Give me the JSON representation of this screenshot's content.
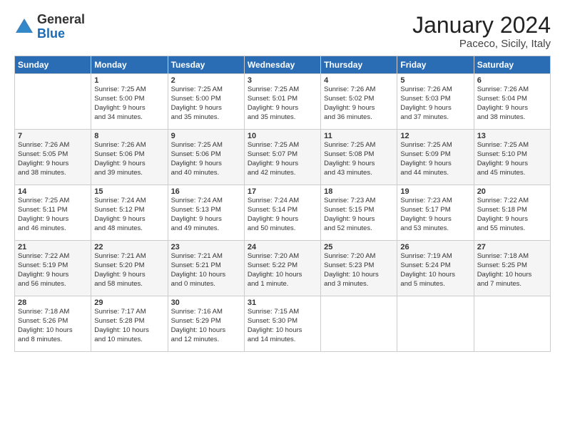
{
  "header": {
    "logo_general": "General",
    "logo_blue": "Blue",
    "month": "January 2024",
    "location": "Paceco, Sicily, Italy"
  },
  "days_of_week": [
    "Sunday",
    "Monday",
    "Tuesday",
    "Wednesday",
    "Thursday",
    "Friday",
    "Saturday"
  ],
  "weeks": [
    [
      {
        "day": "",
        "info": ""
      },
      {
        "day": "1",
        "info": "Sunrise: 7:25 AM\nSunset: 5:00 PM\nDaylight: 9 hours\nand 34 minutes."
      },
      {
        "day": "2",
        "info": "Sunrise: 7:25 AM\nSunset: 5:00 PM\nDaylight: 9 hours\nand 35 minutes."
      },
      {
        "day": "3",
        "info": "Sunrise: 7:25 AM\nSunset: 5:01 PM\nDaylight: 9 hours\nand 35 minutes."
      },
      {
        "day": "4",
        "info": "Sunrise: 7:26 AM\nSunset: 5:02 PM\nDaylight: 9 hours\nand 36 minutes."
      },
      {
        "day": "5",
        "info": "Sunrise: 7:26 AM\nSunset: 5:03 PM\nDaylight: 9 hours\nand 37 minutes."
      },
      {
        "day": "6",
        "info": "Sunrise: 7:26 AM\nSunset: 5:04 PM\nDaylight: 9 hours\nand 38 minutes."
      }
    ],
    [
      {
        "day": "7",
        "info": "Sunrise: 7:26 AM\nSunset: 5:05 PM\nDaylight: 9 hours\nand 38 minutes."
      },
      {
        "day": "8",
        "info": "Sunrise: 7:26 AM\nSunset: 5:06 PM\nDaylight: 9 hours\nand 39 minutes."
      },
      {
        "day": "9",
        "info": "Sunrise: 7:25 AM\nSunset: 5:06 PM\nDaylight: 9 hours\nand 40 minutes."
      },
      {
        "day": "10",
        "info": "Sunrise: 7:25 AM\nSunset: 5:07 PM\nDaylight: 9 hours\nand 42 minutes."
      },
      {
        "day": "11",
        "info": "Sunrise: 7:25 AM\nSunset: 5:08 PM\nDaylight: 9 hours\nand 43 minutes."
      },
      {
        "day": "12",
        "info": "Sunrise: 7:25 AM\nSunset: 5:09 PM\nDaylight: 9 hours\nand 44 minutes."
      },
      {
        "day": "13",
        "info": "Sunrise: 7:25 AM\nSunset: 5:10 PM\nDaylight: 9 hours\nand 45 minutes."
      }
    ],
    [
      {
        "day": "14",
        "info": "Sunrise: 7:25 AM\nSunset: 5:11 PM\nDaylight: 9 hours\nand 46 minutes."
      },
      {
        "day": "15",
        "info": "Sunrise: 7:24 AM\nSunset: 5:12 PM\nDaylight: 9 hours\nand 48 minutes."
      },
      {
        "day": "16",
        "info": "Sunrise: 7:24 AM\nSunset: 5:13 PM\nDaylight: 9 hours\nand 49 minutes."
      },
      {
        "day": "17",
        "info": "Sunrise: 7:24 AM\nSunset: 5:14 PM\nDaylight: 9 hours\nand 50 minutes."
      },
      {
        "day": "18",
        "info": "Sunrise: 7:23 AM\nSunset: 5:15 PM\nDaylight: 9 hours\nand 52 minutes."
      },
      {
        "day": "19",
        "info": "Sunrise: 7:23 AM\nSunset: 5:17 PM\nDaylight: 9 hours\nand 53 minutes."
      },
      {
        "day": "20",
        "info": "Sunrise: 7:22 AM\nSunset: 5:18 PM\nDaylight: 9 hours\nand 55 minutes."
      }
    ],
    [
      {
        "day": "21",
        "info": "Sunrise: 7:22 AM\nSunset: 5:19 PM\nDaylight: 9 hours\nand 56 minutes."
      },
      {
        "day": "22",
        "info": "Sunrise: 7:21 AM\nSunset: 5:20 PM\nDaylight: 9 hours\nand 58 minutes."
      },
      {
        "day": "23",
        "info": "Sunrise: 7:21 AM\nSunset: 5:21 PM\nDaylight: 10 hours\nand 0 minutes."
      },
      {
        "day": "24",
        "info": "Sunrise: 7:20 AM\nSunset: 5:22 PM\nDaylight: 10 hours\nand 1 minute."
      },
      {
        "day": "25",
        "info": "Sunrise: 7:20 AM\nSunset: 5:23 PM\nDaylight: 10 hours\nand 3 minutes."
      },
      {
        "day": "26",
        "info": "Sunrise: 7:19 AM\nSunset: 5:24 PM\nDaylight: 10 hours\nand 5 minutes."
      },
      {
        "day": "27",
        "info": "Sunrise: 7:18 AM\nSunset: 5:25 PM\nDaylight: 10 hours\nand 7 minutes."
      }
    ],
    [
      {
        "day": "28",
        "info": "Sunrise: 7:18 AM\nSunset: 5:26 PM\nDaylight: 10 hours\nand 8 minutes."
      },
      {
        "day": "29",
        "info": "Sunrise: 7:17 AM\nSunset: 5:28 PM\nDaylight: 10 hours\nand 10 minutes."
      },
      {
        "day": "30",
        "info": "Sunrise: 7:16 AM\nSunset: 5:29 PM\nDaylight: 10 hours\nand 12 minutes."
      },
      {
        "day": "31",
        "info": "Sunrise: 7:15 AM\nSunset: 5:30 PM\nDaylight: 10 hours\nand 14 minutes."
      },
      {
        "day": "",
        "info": ""
      },
      {
        "day": "",
        "info": ""
      },
      {
        "day": "",
        "info": ""
      }
    ]
  ]
}
